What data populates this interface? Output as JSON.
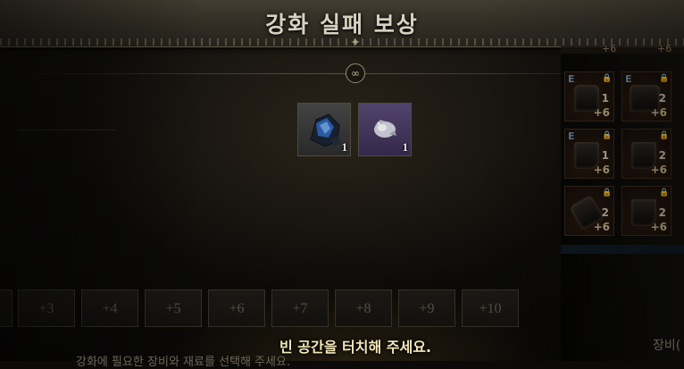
{
  "title": "강화 실패 보상",
  "rewards": [
    {
      "icon": "blue-ore-icon",
      "count": "1",
      "color": "#4a4a4a"
    },
    {
      "icon": "white-crystal-icon",
      "count": "1",
      "color": "#5a4a78"
    }
  ],
  "levels": [
    "+3",
    "+4",
    "+5",
    "+6",
    "+7",
    "+8",
    "+9",
    "+10"
  ],
  "inventory": [
    {
      "letter": "E",
      "mid": "1",
      "plus": "+6",
      "icon": "helmet-icon"
    },
    {
      "letter": "E",
      "mid": "2",
      "plus": "+6",
      "icon": "chest-armor-icon"
    },
    {
      "letter": "E",
      "mid": "1",
      "plus": "+6",
      "icon": "boots-icon"
    },
    {
      "letter": "",
      "mid": "2",
      "plus": "+6",
      "icon": "boots-icon"
    },
    {
      "letter": "",
      "mid": "2",
      "plus": "+6",
      "icon": "gloves-icon"
    },
    {
      "letter": "",
      "mid": "2",
      "plus": "+6",
      "icon": "boots-icon"
    }
  ],
  "inventory_top": [
    "+6",
    "+6"
  ],
  "prompt": "빈 공간을 터치해 주세요.",
  "inventory_label": "장비(",
  "bottom_hint": "강화에 필요한 장비와 재료를 선택해 주세요."
}
